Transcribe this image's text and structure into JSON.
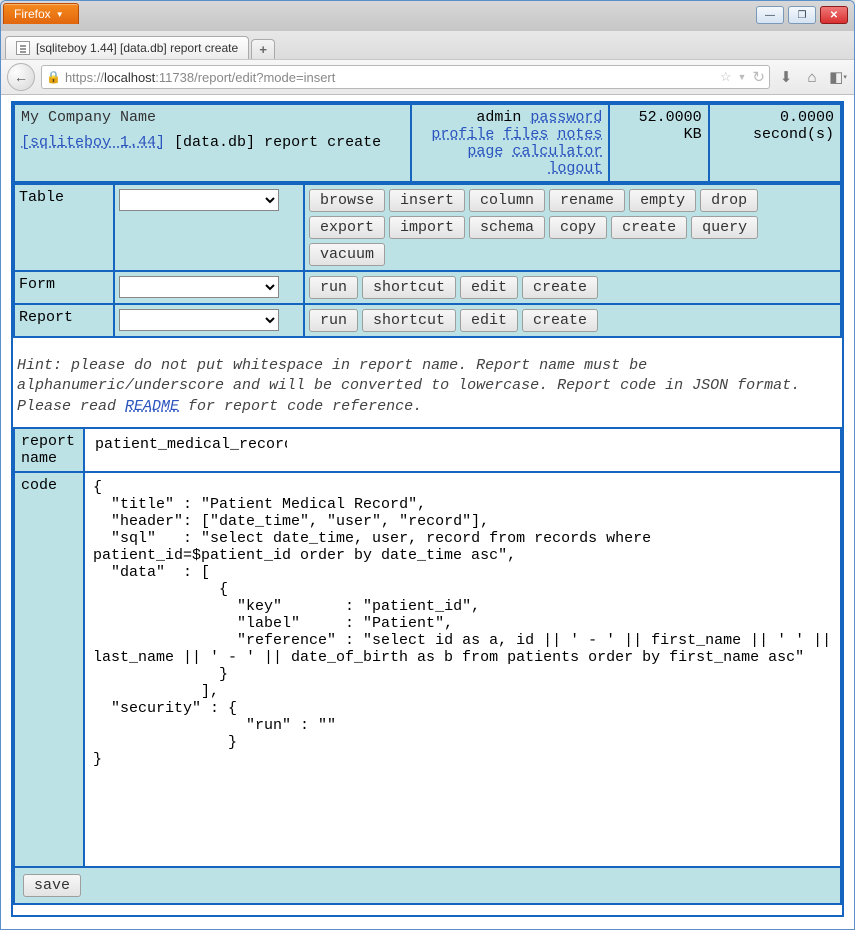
{
  "browser": {
    "name": "Firefox",
    "tab_title": "[sqliteboy 1.44] [data.db] report create",
    "url_scheme": "https://",
    "url_host": "localhost",
    "url_port": ":11738",
    "url_path": "/report/edit?mode=insert"
  },
  "header": {
    "company": "My Company Name",
    "app_link": "[sqliteboy 1.44]",
    "db_label": "[data.db] report create",
    "admin_label": "admin",
    "links": {
      "password": "password",
      "profile": "profile",
      "files": "files",
      "notes": "notes",
      "page": "page",
      "calculator": "calculator",
      "logout": "logout"
    },
    "size_value": "52.0000",
    "size_unit": "KB",
    "time_value": "0.0000",
    "time_unit": "second(s)"
  },
  "rows": {
    "table_label": "Table",
    "form_label": "Form",
    "report_label": "Report"
  },
  "table_buttons": [
    "browse",
    "insert",
    "column",
    "rename",
    "empty",
    "drop",
    "export",
    "import",
    "schema",
    "copy",
    "create",
    "query",
    "vacuum"
  ],
  "form_buttons": [
    "run",
    "shortcut",
    "edit",
    "create"
  ],
  "report_buttons": [
    "run",
    "shortcut",
    "edit",
    "create"
  ],
  "hint": {
    "text_before": "Hint: please do not put whitespace in report name. Report name must be alphanumeric/underscore and will be converted to lowercase. Report code in JSON format. Please read ",
    "readme": "README",
    "text_after": " for report code reference."
  },
  "form": {
    "report_name_label": "report name",
    "report_name_value": "patient_medical_record",
    "code_label": "code",
    "code_value": "{\n  \"title\" : \"Patient Medical Record\",\n  \"header\": [\"date_time\", \"user\", \"record\"],\n  \"sql\"   : \"select date_time, user, record from records where patient_id=$patient_id order by date_time asc\",\n  \"data\"  : [\n              {\n                \"key\"       : \"patient_id\",\n                \"label\"     : \"Patient\",\n                \"reference\" : \"select id as a, id || ' - ' || first_name || ' ' || last_name || ' - ' || date_of_birth as b from patients order by first_name asc\"\n              }\n            ],\n  \"security\" : {\n                 \"run\" : \"\"\n               }\n}",
    "save_label": "save"
  }
}
